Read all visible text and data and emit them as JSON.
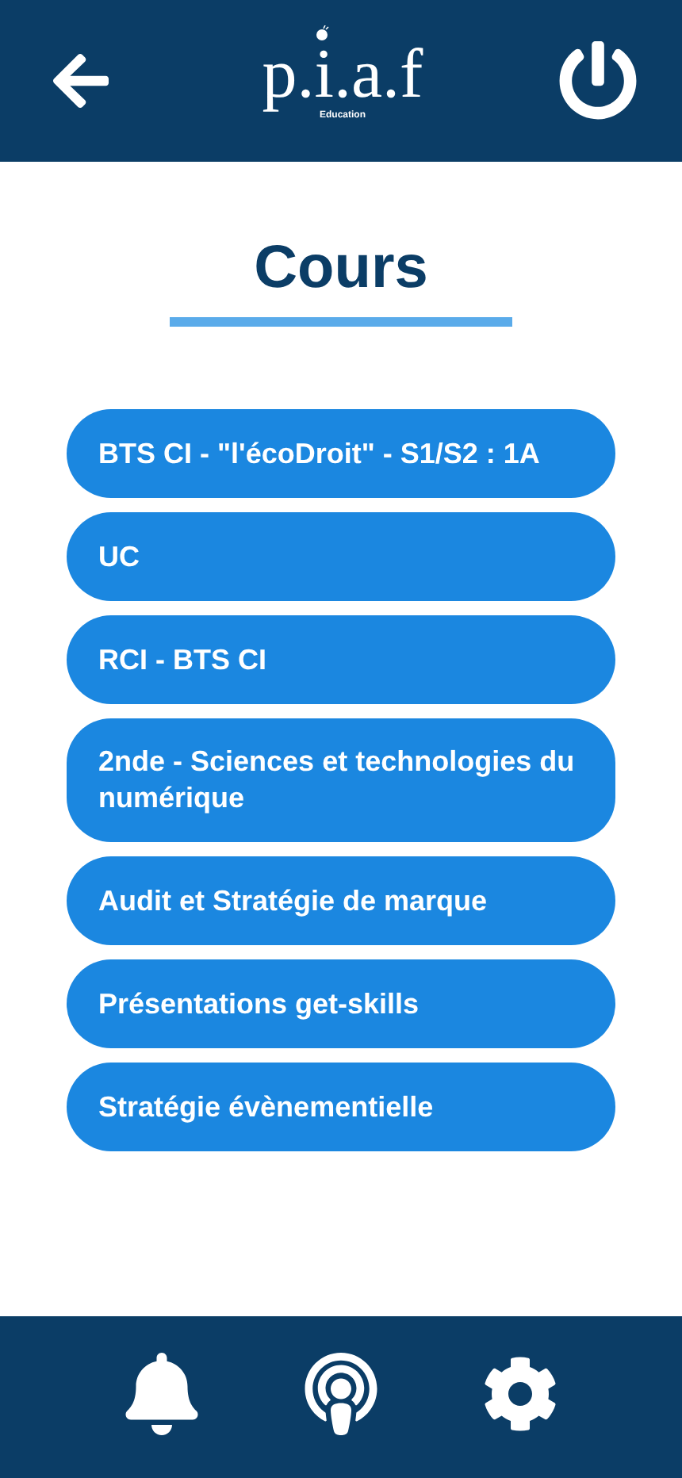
{
  "header": {
    "logo": {
      "name": "p.i.a.f",
      "tagline": "Education"
    }
  },
  "title": "Cours",
  "courses": [
    {
      "label": "BTS CI - \"l'écoDroit\" - S1/S2 : 1A"
    },
    {
      "label": "UC"
    },
    {
      "label": "RCI - BTS CI"
    },
    {
      "label": "2nde - Sciences et technologies du numérique"
    },
    {
      "label": "Audit et Stratégie de marque"
    },
    {
      "label": "Présentations get-skills"
    },
    {
      "label": "Stratégie évènementielle"
    }
  ]
}
